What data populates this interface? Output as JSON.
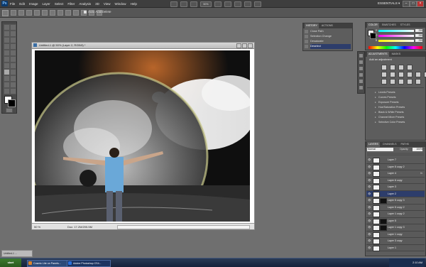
{
  "app": {
    "logo": "Ps",
    "workspace_label": "ESSENTIALS ▾"
  },
  "menu": [
    "File",
    "Edit",
    "Image",
    "Layer",
    "Select",
    "Filter",
    "Analysis",
    "3D",
    "View",
    "Window",
    "Help"
  ],
  "zoom_level": "50%",
  "options_bar": {
    "auto_select_label": "Auto Add/Delete"
  },
  "document": {
    "title": "Untitled-1 @ 50% (Layer 2, RGB/8) *",
    "zoom": "50 %",
    "doc_size": "Doc: 17.2M/205.5M"
  },
  "history_panel": {
    "tabs": [
      "HISTORY",
      "ACTIONS"
    ],
    "items": [
      "Close Path",
      "Selection Change",
      "Desaturate",
      "Deselect"
    ]
  },
  "color_panel": {
    "tabs": [
      "COLOR",
      "SWATCHES",
      "STYLES"
    ],
    "channels": [
      {
        "label": "R",
        "value": "255"
      },
      {
        "label": "G",
        "value": "255"
      },
      {
        "label": "B",
        "value": "255"
      }
    ]
  },
  "adjustments_panel": {
    "tabs": [
      "ADJUSTMENTS",
      "MASKS"
    ],
    "heading": "Add an adjustment",
    "presets": [
      "Levels Presets",
      "Curves Presets",
      "Exposure Presets",
      "Hue/Saturation Presets",
      "Black & White Presets",
      "Channel Mixer Presets",
      "Selective Color Presets"
    ]
  },
  "layers_panel": {
    "tabs": [
      "LAYERS",
      "CHANNELS",
      "PATHS"
    ],
    "blend_mode": "Normal",
    "opacity_label": "Opacity:",
    "opacity_value": "100%",
    "layers": [
      {
        "name": "Layer 7",
        "selected": false,
        "fx": ""
      },
      {
        "name": "Layer 5 copy 2",
        "selected": false,
        "fx": ""
      },
      {
        "name": "Layer 4",
        "selected": false,
        "fx": "fx"
      },
      {
        "name": "Layer 6 copy",
        "selected": false,
        "fx": ""
      },
      {
        "name": "Layer 3",
        "selected": false,
        "fx": ""
      },
      {
        "name": "Layer 2",
        "selected": true,
        "fx": ""
      },
      {
        "name": "Layer 5 copy 3",
        "selected": false,
        "fx": ""
      },
      {
        "name": "Layer 5 copy 2",
        "selected": false,
        "fx": ""
      },
      {
        "name": "Layer 1 copy 2",
        "selected": false,
        "fx": ""
      },
      {
        "name": "Layer 5",
        "selected": false,
        "fx": ""
      },
      {
        "name": "Layer 1 copy 3",
        "selected": false,
        "fx": ""
      },
      {
        "name": "Layer 1 copy",
        "selected": false,
        "fx": ""
      },
      {
        "name": "Layer 3 copy",
        "selected": false,
        "fx": ""
      },
      {
        "name": "Layer 1",
        "selected": false,
        "fx": ""
      }
    ]
  },
  "minimized_doc": "Untitled-1 ...",
  "taskbar": {
    "start": "start",
    "tasks": [
      {
        "label": "Cosmic Lite on Panels...",
        "color": "#d9822b"
      },
      {
        "label": "Adobe Photoshop CS4...",
        "color": "#2b6fd9"
      }
    ],
    "clock": "2:10 AM"
  },
  "colors": {
    "selection": "#2d3d6b",
    "panel_bg": "#5d5d5d",
    "workspace_bg": "#6f6f6f"
  }
}
